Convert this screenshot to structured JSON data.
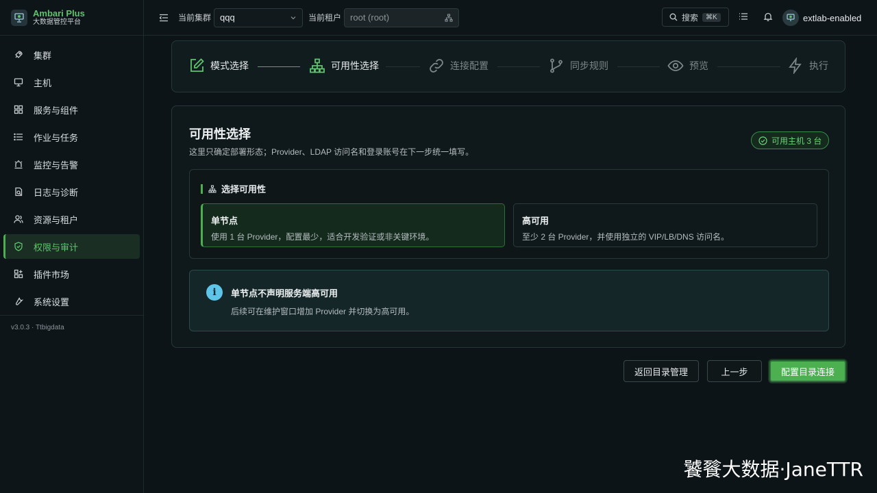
{
  "brand": {
    "title": "Ambari Plus",
    "subtitle": "大数据管控平台"
  },
  "sidebar": {
    "items": [
      {
        "label": "集群",
        "icon": "rocket-icon"
      },
      {
        "label": "主机",
        "icon": "monitor-icon"
      },
      {
        "label": "服务与组件",
        "icon": "grid-icon"
      },
      {
        "label": "作业与任务",
        "icon": "list-icon"
      },
      {
        "label": "监控与告警",
        "icon": "alarm-icon"
      },
      {
        "label": "日志与诊断",
        "icon": "log-icon"
      },
      {
        "label": "资源与租户",
        "icon": "users-icon"
      },
      {
        "label": "权限与审计",
        "icon": "shield-icon",
        "active": true
      },
      {
        "label": "插件市场",
        "icon": "plugin-icon"
      },
      {
        "label": "系统设置",
        "icon": "wrench-icon"
      }
    ],
    "version": "v3.0.3 · Ttbigdata"
  },
  "header": {
    "cluster_label": "当前集群",
    "cluster_value": "qqq",
    "tenant_label": "当前租户",
    "tenant_value": "root (root)",
    "search_label": "搜索",
    "search_shortcut": "⌘K",
    "username": "extlab-enabled"
  },
  "stepper": {
    "steps": [
      {
        "label": "模式选择",
        "state": "done"
      },
      {
        "label": "可用性选择",
        "state": "current"
      },
      {
        "label": "连接配置",
        "state": "pending"
      },
      {
        "label": "同步规则",
        "state": "pending"
      },
      {
        "label": "预览",
        "state": "pending"
      },
      {
        "label": "执行",
        "state": "pending"
      }
    ]
  },
  "card": {
    "title": "可用性选择",
    "subtitle": "这里只确定部署形态；Provider、LDAP 访问名和登录账号在下一步统一填写。",
    "badge": "可用主机 3 台",
    "section_title": "选择可用性",
    "options": [
      {
        "title": "单节点",
        "desc": "使用 1 台 Provider，配置最少，适合开发验证或非关键环境。",
        "selected": true
      },
      {
        "title": "高可用",
        "desc": "至少 2 台 Provider，并使用独立的 VIP/LB/DNS 访问名。",
        "selected": false
      }
    ],
    "info_title": "单节点不声明服务端高可用",
    "info_desc": "后续可在维护窗口增加 Provider 并切换为高可用。"
  },
  "actions": {
    "back_to_catalog": "返回目录管理",
    "prev": "上一步",
    "next": "配置目录连接"
  },
  "watermark": "饕餮大数据·JaneTTR",
  "colors": {
    "accent": "#4caf50",
    "info": "#5ec5e8",
    "background": "#0d1417"
  }
}
